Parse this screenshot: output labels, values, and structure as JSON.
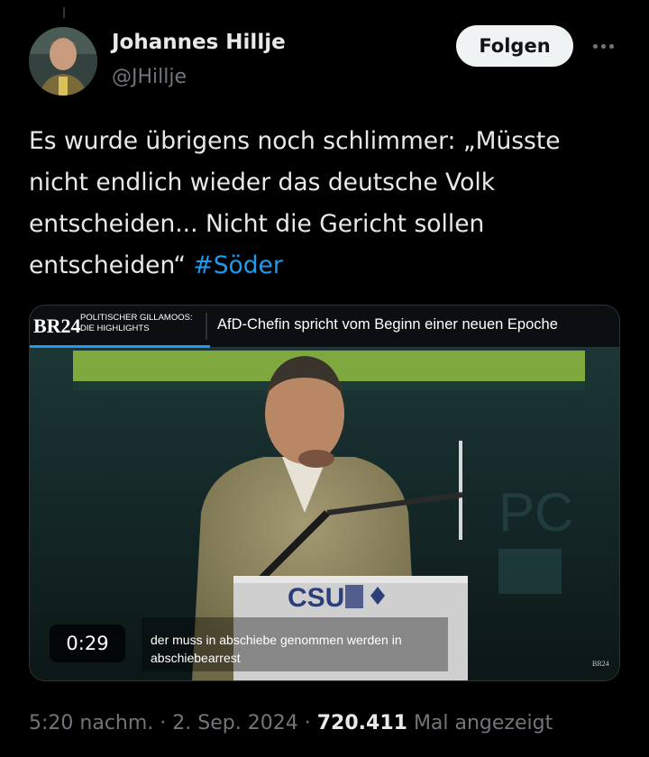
{
  "author": {
    "name": "Johannes Hillje",
    "handle": "@JHillje"
  },
  "actions": {
    "follow_label": "Folgen",
    "more_icon": "more-horizontal-icon"
  },
  "tweet": {
    "text": "Es wurde übrigens noch schlimmer: „Müsste nicht endlich wieder das deutsche Volk entscheiden... Nicht die Gericht sollen entscheiden“ ",
    "hashtag": "#Söder"
  },
  "video": {
    "logo": "BR24",
    "program_line1": "POLITISCHER GILLAMOOS:",
    "program_line2": "DIE HIGHLIGHTS",
    "headline": "AfD-Chefin spricht vom Beginn einer neuen Epoche",
    "lectern_text": "CSU",
    "subtitle_line1": "der muss in abschiebe genommen werden in",
    "subtitle_line2": "abschiebearrest",
    "watermark": "BR24",
    "timestamp": "0:29"
  },
  "meta": {
    "time": "5:20 nachm.",
    "separator": "·",
    "date": "2. Sep. 2024",
    "views_count": "720.411",
    "views_label": "Mal angezeigt"
  },
  "colors": {
    "background": "#000000",
    "text_primary": "#e7e9ea",
    "text_secondary": "#71767b",
    "link": "#1d9bf0",
    "follow_bg": "#eff3f4"
  }
}
